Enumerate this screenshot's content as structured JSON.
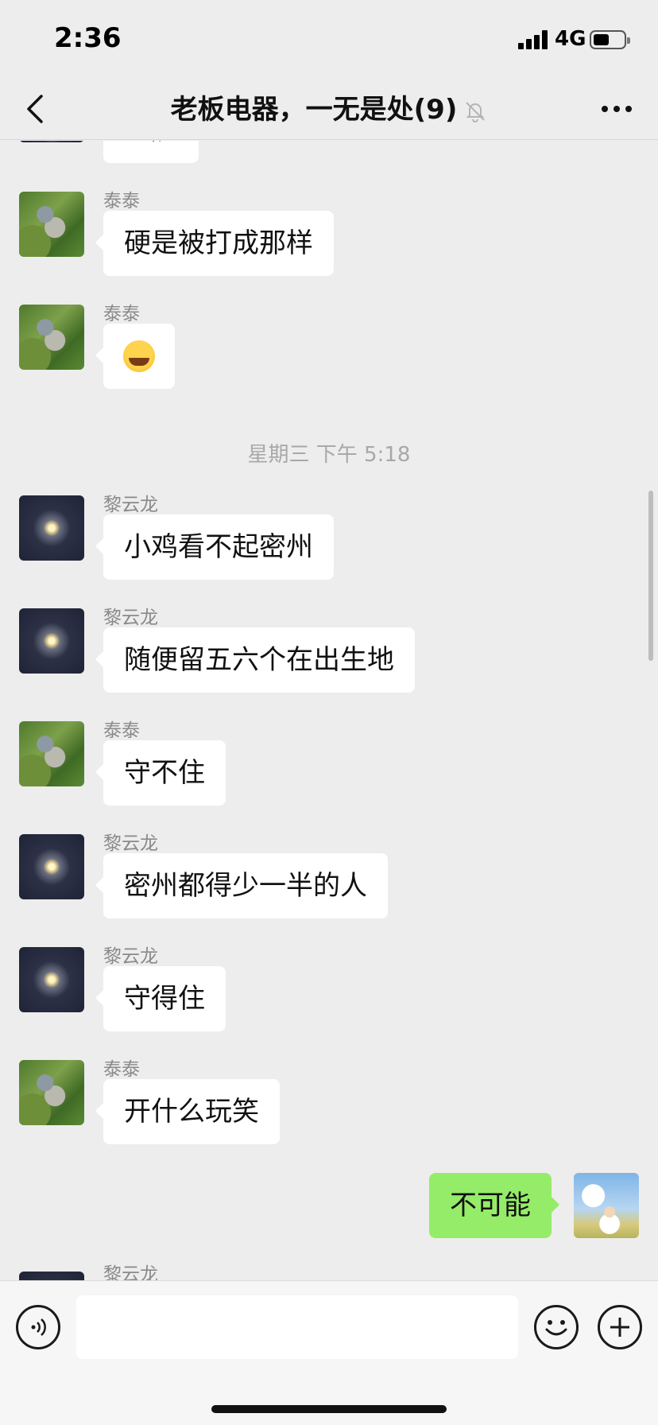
{
  "status_bar": {
    "time": "2:36",
    "network": "4G",
    "battery_level": 0.45
  },
  "nav": {
    "title": "老板电器，一无是处(9)",
    "back_icon": "chevron-left-icon",
    "mute_icon": "bell-off-icon",
    "more_icon": "ellipsis-icon"
  },
  "chat": {
    "partial_top": {
      "text": "星辰"
    },
    "messages": [
      {
        "sender": "泰泰",
        "text": "硬是被打成那样",
        "side": "left"
      },
      {
        "sender": "泰泰",
        "text": "",
        "emoji": "laughing-face-emoji",
        "side": "left"
      },
      {
        "timestamp": "星期三 下午 5:18"
      },
      {
        "sender": "黎云龙",
        "text": "小鸡看不起密州",
        "side": "left"
      },
      {
        "sender": "黎云龙",
        "text": "随便留五六个在出生地",
        "side": "left"
      },
      {
        "sender": "泰泰",
        "text": "守不住",
        "side": "left"
      },
      {
        "sender": "黎云龙",
        "text": "密州都得少一半的人",
        "side": "left"
      },
      {
        "sender": "黎云龙",
        "text": "守得住",
        "side": "left"
      },
      {
        "sender": "泰泰",
        "text": "开什么玩笑",
        "side": "left"
      },
      {
        "sender": "",
        "text": "不可能",
        "side": "right"
      },
      {
        "sender": "黎云龙",
        "text": "",
        "side": "left"
      }
    ]
  },
  "input_bar": {
    "voice_icon": "voice-icon",
    "emoji_icon": "smiley-icon",
    "plus_icon": "plus-icon",
    "input_value": ""
  }
}
